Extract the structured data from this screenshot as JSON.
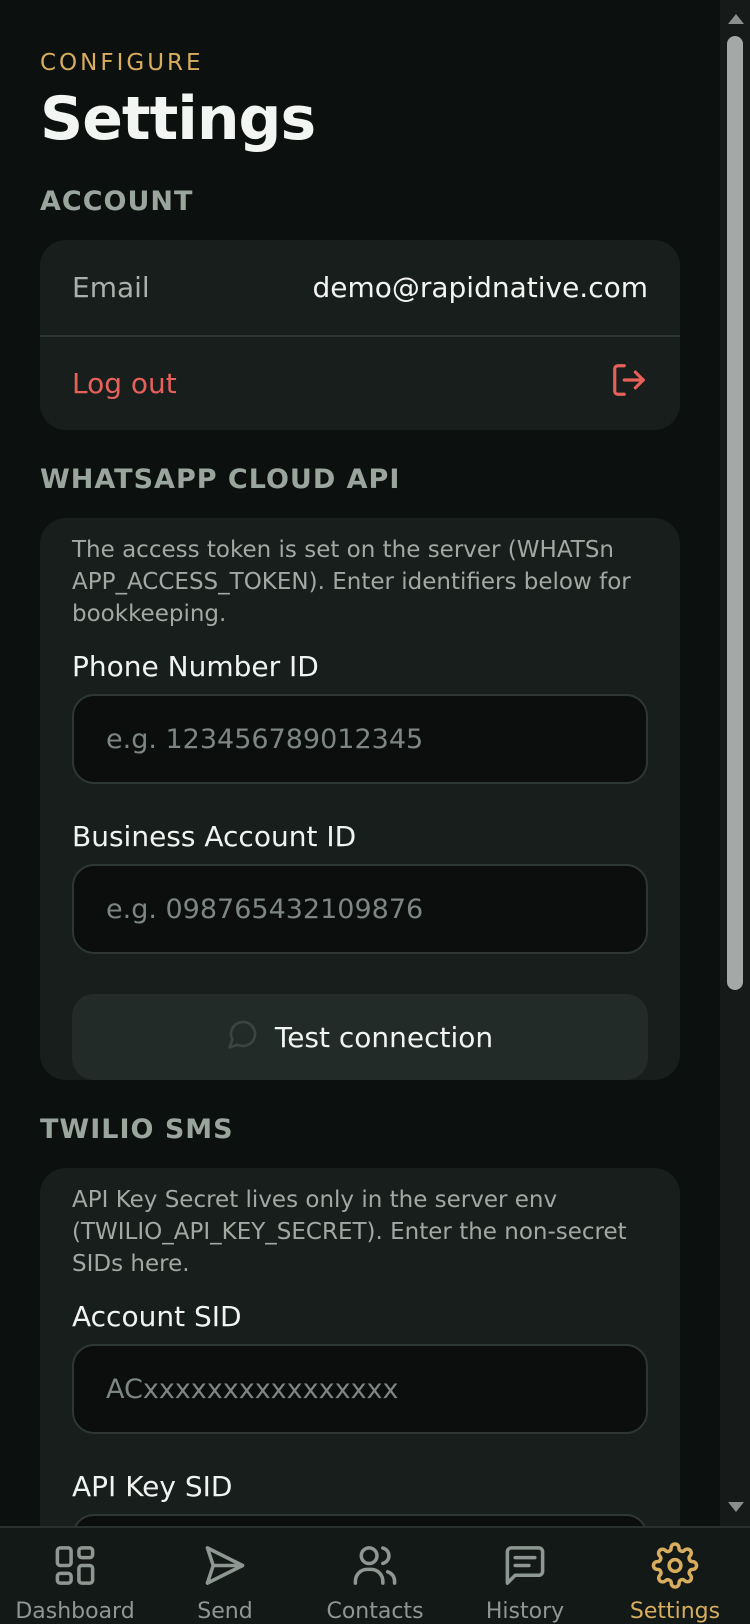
{
  "header": {
    "eyebrow": "CONFIGURE",
    "title": "Settings"
  },
  "account": {
    "section_title": "ACCOUNT",
    "email_label": "Email",
    "email_value": "demo@rapidnative.com",
    "logout_label": "Log out"
  },
  "whatsapp": {
    "section_title": "WHATSAPP CLOUD API",
    "help": "The access token is set on the server (WHATSn APP_ACCESS_TOKEN). Enter identifiers below for bookkeeping.",
    "phone_label": "Phone Number ID",
    "phone_placeholder": "e.g. 123456789012345",
    "business_label": "Business Account ID",
    "business_placeholder": "e.g. 098765432109876",
    "test_button": "Test connection"
  },
  "twilio": {
    "section_title": "TWILIO SMS",
    "help": "API Key Secret lives only in the server env (TWILIO_API_KEY_SECRET). Enter the non-secret SIDs here.",
    "account_sid_label": "Account SID",
    "account_sid_placeholder": "ACxxxxxxxxxxxxxxxx",
    "api_key_label": "API Key SID"
  },
  "tabs": [
    {
      "label": "Dashboard",
      "icon": "grid-icon"
    },
    {
      "label": "Send",
      "icon": "send-icon"
    },
    {
      "label": "Contacts",
      "icon": "users-icon"
    },
    {
      "label": "History",
      "icon": "message-square-icon"
    },
    {
      "label": "Settings",
      "icon": "gear-icon",
      "active": true
    }
  ],
  "colors": {
    "accent": "#d8ad5d",
    "danger": "#e8605a",
    "background": "#0c1110",
    "card": "#181e1c"
  }
}
